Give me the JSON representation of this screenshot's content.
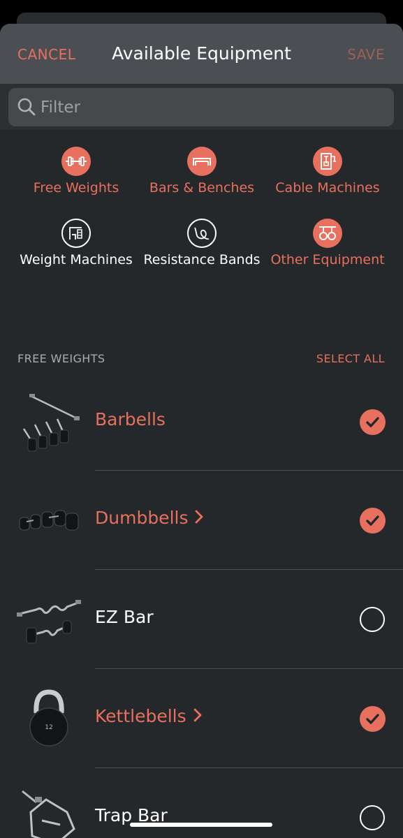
{
  "header": {
    "cancel_label": "CANCEL",
    "title": "Available Equipment",
    "save_label": "SAVE"
  },
  "search": {
    "placeholder": "Filter",
    "value": ""
  },
  "categories": [
    {
      "label": "Free Weights",
      "icon": "dumbbell-icon",
      "active": true
    },
    {
      "label": "Bars & Benches",
      "icon": "bench-icon",
      "active": true
    },
    {
      "label": "Cable Machines",
      "icon": "cable-machine-icon",
      "active": true
    },
    {
      "label": "Weight Machines",
      "icon": "weight-machine-icon",
      "active": false
    },
    {
      "label": "Resistance Bands",
      "icon": "resistance-band-icon",
      "active": false
    },
    {
      "label": "Other Equipment",
      "icon": "gymnastic-rings-icon",
      "active": true
    }
  ],
  "section": {
    "title": "FREE WEIGHTS",
    "select_all_label": "SELECT ALL"
  },
  "items": [
    {
      "name": "Barbells",
      "selected": true,
      "has_submenu": false,
      "icon": "barbells-image"
    },
    {
      "name": "Dumbbells",
      "selected": true,
      "has_submenu": true,
      "icon": "dumbbells-image"
    },
    {
      "name": "EZ Bar",
      "selected": false,
      "has_submenu": false,
      "icon": "ez-bar-image"
    },
    {
      "name": "Kettlebells",
      "selected": true,
      "has_submenu": true,
      "icon": "kettlebell-image"
    },
    {
      "name": "Trap Bar",
      "selected": false,
      "has_submenu": false,
      "icon": "trap-bar-image"
    }
  ],
  "colors": {
    "accent": "#e7705e",
    "background": "#25282a",
    "header": "#4b4f53"
  }
}
